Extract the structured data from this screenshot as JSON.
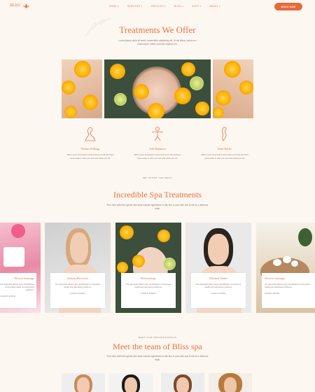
{
  "header": {
    "logo": "BLISS",
    "nav": [
      "HOME ▾",
      "SERVICES ▾",
      "SERVICES ▾",
      "BLOG ▾",
      "SHOP ▾",
      "ABOUT ▾"
    ],
    "book_label": "BOOK NOW",
    "accent": "#e86a3a"
  },
  "treatments": {
    "title": "Treatments We Offer",
    "subtitle": "Lorem ipsum dolor sit amet, consectetur adipiscing elit. Ut elit tellus, luctus nec ullamcorper mattis, pulvinar dapibus leo."
  },
  "features": [
    {
      "icon": "woman-silhouette-icon",
      "title": "Waxes Polling",
      "text": "When your innerself is at its best you look and feel more ease in who you are and what you do."
    },
    {
      "icon": "body-balance-icon",
      "title": "Self Balance",
      "text": "When your innerself is at its best you look and feel more ease in who you are and what you do."
    },
    {
      "icon": "spa-woman-icon",
      "title": "Diet Baths",
      "text": "When your innerself is at its best you look and feel more ease in who you are and what you do."
    }
  ],
  "spa": {
    "eyebrow": "WE OFFER THE BEST",
    "title": "Incredible Spa Treatments",
    "subtitle": "Find here with their gentle skin wear natural ingredients to like fine in your skin and it will be a delicious ritual.",
    "cards": [
      {
        "title": "Flower massage",
        "text": "Our approach allows early identification of important health and well-being problems.",
        "link": "LEARN MORE"
      },
      {
        "title": "Ashtest Recovery",
        "text": "Our approach allows early identification of important health and well-being problems.",
        "link": "LEARN MORE"
      },
      {
        "title": "Reflexology",
        "text": "Our approach allows early identification of important health and well-being problems.",
        "link": "LEARN MORE"
      },
      {
        "title": "Thermal Home",
        "text": "Our approach allows early identification of important health and well-being problems.",
        "link": "LEARN MORE"
      },
      {
        "title": "Shower massage",
        "text": "Our approach allows early identification of important health and well-being problems.",
        "link": "LEARN MORE"
      }
    ]
  },
  "team": {
    "eyebrow": "MEET OUR PROFESSIONALS",
    "title": "Meet the team of Bliss spa",
    "subtitle": "Find here with their gentle skin wear natural ingredients to like fine in your skin and it will be a delicious ritual."
  }
}
